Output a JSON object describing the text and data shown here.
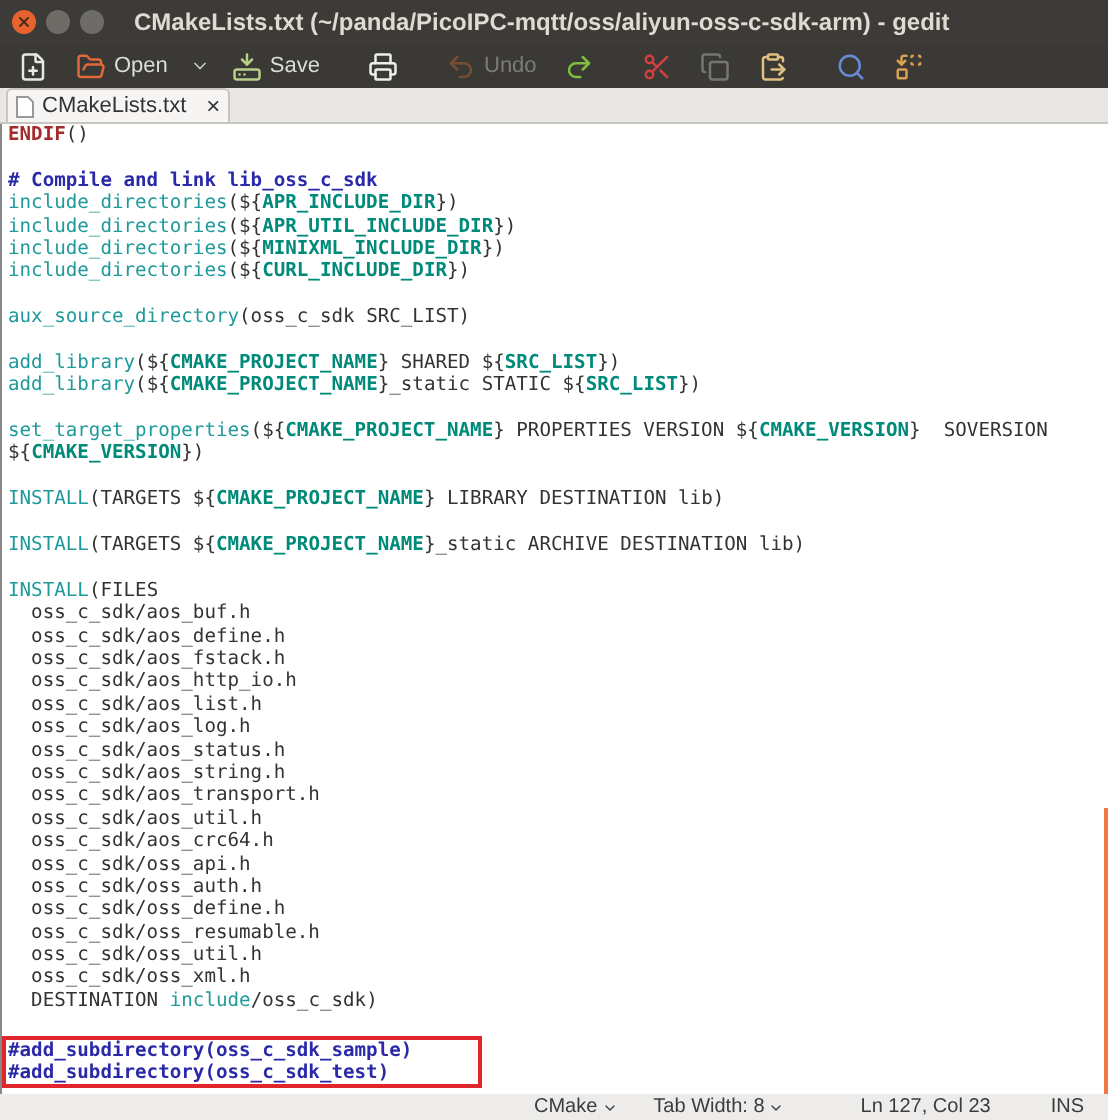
{
  "window": {
    "title": "CMakeLists.txt (~/panda/PicoIPC-mqtt/oss/aliyun-oss-c-sdk-arm) - gedit"
  },
  "toolbar": [
    {
      "kind": "new",
      "disabled": false
    },
    {
      "kind": "open",
      "label": "Open",
      "disabled": false
    },
    {
      "kind": "save",
      "label": "Save",
      "disabled": false
    },
    {
      "kind": "print",
      "disabled": false
    },
    {
      "kind": "undo",
      "label": "Undo",
      "disabled": true
    },
    {
      "kind": "redo",
      "disabled": false
    },
    {
      "kind": "cut",
      "disabled": false
    },
    {
      "kind": "copy",
      "disabled": true
    },
    {
      "kind": "paste",
      "disabled": false
    },
    {
      "kind": "search",
      "disabled": false
    },
    {
      "kind": "replace",
      "disabled": false
    }
  ],
  "tabs": [
    {
      "label": "CMakeLists.txt",
      "selected": true,
      "close": "×"
    }
  ],
  "editor": {
    "lines": [
      {
        "kind": "code",
        "spans": [
          {
            "kind": "keyword",
            "text": "ENDIF"
          },
          {
            "kind": "plain",
            "text": "()"
          }
        ]
      },
      {
        "kind": "blank"
      },
      {
        "kind": "code",
        "spans": [
          {
            "kind": "comment",
            "text": "# Compile and link lib_oss_c_sdk"
          }
        ]
      },
      {
        "kind": "code",
        "spans": [
          {
            "kind": "command",
            "text": "include_directories"
          },
          {
            "kind": "plain",
            "text": "(${"
          },
          {
            "kind": "variable",
            "text": "APR_INCLUDE_DIR"
          },
          {
            "kind": "plain",
            "text": "})"
          }
        ]
      },
      {
        "kind": "code",
        "spans": [
          {
            "kind": "command",
            "text": "include_directories"
          },
          {
            "kind": "plain",
            "text": "(${"
          },
          {
            "kind": "variable",
            "text": "APR_UTIL_INCLUDE_DIR"
          },
          {
            "kind": "plain",
            "text": "})"
          }
        ]
      },
      {
        "kind": "code",
        "spans": [
          {
            "kind": "command",
            "text": "include_directories"
          },
          {
            "kind": "plain",
            "text": "(${"
          },
          {
            "kind": "variable",
            "text": "MINIXML_INCLUDE_DIR"
          },
          {
            "kind": "plain",
            "text": "})"
          }
        ]
      },
      {
        "kind": "code",
        "spans": [
          {
            "kind": "command",
            "text": "include_directories"
          },
          {
            "kind": "plain",
            "text": "(${"
          },
          {
            "kind": "variable",
            "text": "CURL_INCLUDE_DIR"
          },
          {
            "kind": "plain",
            "text": "})"
          }
        ]
      },
      {
        "kind": "blank"
      },
      {
        "kind": "code",
        "spans": [
          {
            "kind": "command",
            "text": "aux_source_directory"
          },
          {
            "kind": "plain",
            "text": "(oss_c_sdk SRC_LIST)"
          }
        ]
      },
      {
        "kind": "blank"
      },
      {
        "kind": "code",
        "spans": [
          {
            "kind": "command",
            "text": "add_library"
          },
          {
            "kind": "plain",
            "text": "(${"
          },
          {
            "kind": "variable",
            "text": "CMAKE_PROJECT_NAME"
          },
          {
            "kind": "plain",
            "text": "} SHARED ${"
          },
          {
            "kind": "variable",
            "text": "SRC_LIST"
          },
          {
            "kind": "plain",
            "text": "})"
          }
        ]
      },
      {
        "kind": "code",
        "spans": [
          {
            "kind": "command",
            "text": "add_library"
          },
          {
            "kind": "plain",
            "text": "(${"
          },
          {
            "kind": "variable",
            "text": "CMAKE_PROJECT_NAME"
          },
          {
            "kind": "plain",
            "text": "}_static STATIC ${"
          },
          {
            "kind": "variable",
            "text": "SRC_LIST"
          },
          {
            "kind": "plain",
            "text": "})"
          }
        ]
      },
      {
        "kind": "blank"
      },
      {
        "kind": "code",
        "spans": [
          {
            "kind": "command",
            "text": "set_target_properties"
          },
          {
            "kind": "plain",
            "text": "(${"
          },
          {
            "kind": "variable",
            "text": "CMAKE_PROJECT_NAME"
          },
          {
            "kind": "plain",
            "text": "} PROPERTIES VERSION ${"
          },
          {
            "kind": "variable",
            "text": "CMAKE_VERSION"
          },
          {
            "kind": "plain",
            "text": "}  SOVERSION"
          }
        ]
      },
      {
        "kind": "code",
        "spans": [
          {
            "kind": "plain",
            "text": "${"
          },
          {
            "kind": "variable",
            "text": "CMAKE_VERSION"
          },
          {
            "kind": "plain",
            "text": "})"
          }
        ]
      },
      {
        "kind": "blank"
      },
      {
        "kind": "code",
        "spans": [
          {
            "kind": "command",
            "text": "INSTALL"
          },
          {
            "kind": "plain",
            "text": "(TARGETS ${"
          },
          {
            "kind": "variable",
            "text": "CMAKE_PROJECT_NAME"
          },
          {
            "kind": "plain",
            "text": "} LIBRARY DESTINATION lib)"
          }
        ]
      },
      {
        "kind": "blank"
      },
      {
        "kind": "code",
        "spans": [
          {
            "kind": "command",
            "text": "INSTALL"
          },
          {
            "kind": "plain",
            "text": "(TARGETS ${"
          },
          {
            "kind": "variable",
            "text": "CMAKE_PROJECT_NAME"
          },
          {
            "kind": "plain",
            "text": "}_static ARCHIVE DESTINATION lib)"
          }
        ]
      },
      {
        "kind": "blank"
      },
      {
        "kind": "code",
        "spans": [
          {
            "kind": "command",
            "text": "INSTALL"
          },
          {
            "kind": "plain",
            "text": "(FILES"
          }
        ]
      },
      {
        "kind": "code",
        "spans": [
          {
            "kind": "plain",
            "text": "  oss_c_sdk/aos_buf.h"
          }
        ]
      },
      {
        "kind": "code",
        "spans": [
          {
            "kind": "plain",
            "text": "  oss_c_sdk/aos_define.h"
          }
        ]
      },
      {
        "kind": "code",
        "spans": [
          {
            "kind": "plain",
            "text": "  oss_c_sdk/aos_fstack.h"
          }
        ]
      },
      {
        "kind": "code",
        "spans": [
          {
            "kind": "plain",
            "text": "  oss_c_sdk/aos_http_io.h"
          }
        ]
      },
      {
        "kind": "code",
        "spans": [
          {
            "kind": "plain",
            "text": "  oss_c_sdk/aos_list.h"
          }
        ]
      },
      {
        "kind": "code",
        "spans": [
          {
            "kind": "plain",
            "text": "  oss_c_sdk/aos_log.h"
          }
        ]
      },
      {
        "kind": "code",
        "spans": [
          {
            "kind": "plain",
            "text": "  oss_c_sdk/aos_status.h"
          }
        ]
      },
      {
        "kind": "code",
        "spans": [
          {
            "kind": "plain",
            "text": "  oss_c_sdk/aos_string.h"
          }
        ]
      },
      {
        "kind": "code",
        "spans": [
          {
            "kind": "plain",
            "text": "  oss_c_sdk/aos_transport.h"
          }
        ]
      },
      {
        "kind": "code",
        "spans": [
          {
            "kind": "plain",
            "text": "  oss_c_sdk/aos_util.h"
          }
        ]
      },
      {
        "kind": "code",
        "spans": [
          {
            "kind": "plain",
            "text": "  oss_c_sdk/aos_crc64.h"
          }
        ]
      },
      {
        "kind": "code",
        "spans": [
          {
            "kind": "plain",
            "text": "  oss_c_sdk/oss_api.h"
          }
        ]
      },
      {
        "kind": "code",
        "spans": [
          {
            "kind": "plain",
            "text": "  oss_c_sdk/oss_auth.h"
          }
        ]
      },
      {
        "kind": "code",
        "spans": [
          {
            "kind": "plain",
            "text": "  oss_c_sdk/oss_define.h"
          }
        ]
      },
      {
        "kind": "code",
        "spans": [
          {
            "kind": "plain",
            "text": "  oss_c_sdk/oss_resumable.h"
          }
        ]
      },
      {
        "kind": "code",
        "spans": [
          {
            "kind": "plain",
            "text": "  oss_c_sdk/oss_util.h"
          }
        ]
      },
      {
        "kind": "code",
        "spans": [
          {
            "kind": "plain",
            "text": "  oss_c_sdk/oss_xml.h"
          }
        ]
      },
      {
        "kind": "code",
        "spans": [
          {
            "kind": "plain",
            "text": "  DESTINATION "
          },
          {
            "kind": "command",
            "text": "include"
          },
          {
            "kind": "plain",
            "text": "/oss_c_sdk)"
          }
        ]
      },
      {
        "kind": "blank"
      }
    ],
    "annotated_lines": [
      {
        "kind": "code",
        "spans": [
          {
            "kind": "comment",
            "text": "#add_subdirectory(oss_c_sdk_sample)"
          }
        ]
      },
      {
        "kind": "code",
        "spans": [
          {
            "kind": "comment",
            "text": "#add_subdirectory(oss_c_sdk_test)"
          }
        ]
      }
    ]
  },
  "status_bar": {
    "language": "CMake",
    "tab_width": "Tab Width: 8",
    "position": "Ln 127, Col 23",
    "mode": "INS"
  }
}
